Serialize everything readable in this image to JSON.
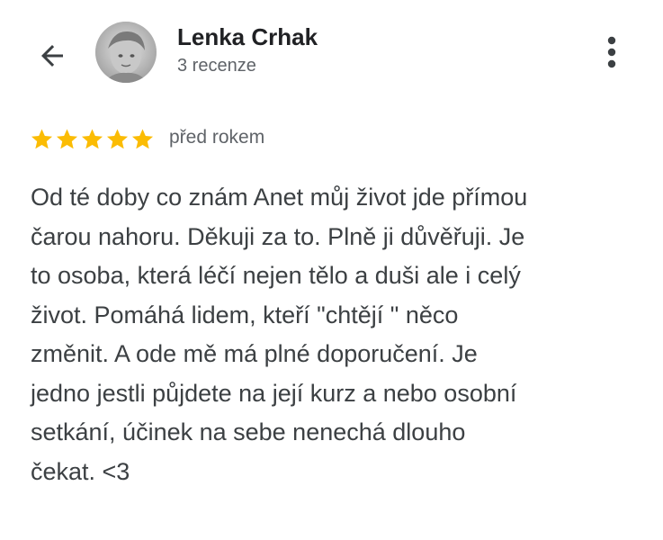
{
  "header": {
    "back_icon": "arrow-left-icon",
    "more_icon": "more-vert-icon",
    "user_name": "Lenka Crhak",
    "review_count": "3 recenze"
  },
  "review": {
    "rating": 5,
    "rating_max": 5,
    "star_color": "#fbbc04",
    "date": "před rokem",
    "text": "Od té doby co znám Anet můj život jde přímou\nčarou nahoru. Děkuji za to. Plně ji důvěřuji. Je\nto osoba, která léčí nejen tělo a duši ale i celý\nživot. Pomáhá lidem, kteří \"chtějí \" něco\nzměnit. A ode mě má plné doporučení. Je\njedno jestli půjdete na její kurz a nebo osobní\nsetkání, účinek na sebe nenechá dlouho\nčekat. <3"
  }
}
